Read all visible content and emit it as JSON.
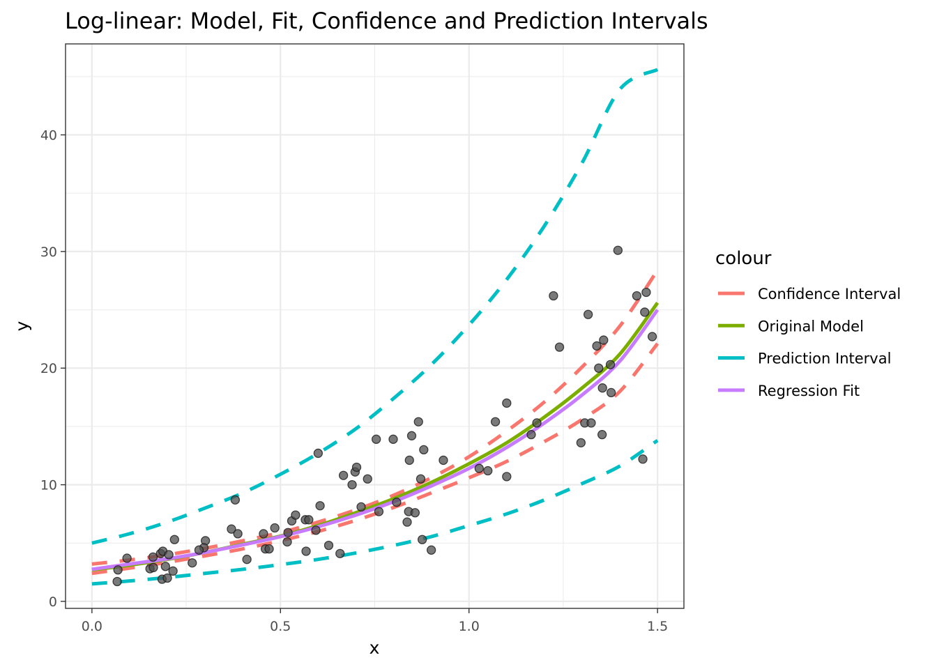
{
  "chart_data": {
    "type": "scatter",
    "title": "Log-linear: Model, Fit, Confidence and Prediction Intervals",
    "xlabel": "x",
    "ylabel": "y",
    "xlim": [
      -0.07,
      1.57
    ],
    "ylim": [
      -0.6,
      47.8
    ],
    "x_ticks": [
      0.0,
      0.5,
      1.0,
      1.5
    ],
    "x_tick_labels": [
      "0.0",
      "0.5",
      "1.0",
      "1.5"
    ],
    "y_ticks": [
      0,
      10,
      20,
      30,
      40
    ],
    "y_tick_labels": [
      "0",
      "10",
      "20",
      "30",
      "40"
    ],
    "grid": true,
    "legend": {
      "title": "colour",
      "position": "right",
      "entries": [
        {
          "label": "Confidence Interval",
          "color": "#F8766D",
          "dash": true
        },
        {
          "label": "Original Model",
          "color": "#7CAE00",
          "dash": false
        },
        {
          "label": "Prediction Interval",
          "color": "#00BFC4",
          "dash": true
        },
        {
          "label": "Regression Fit",
          "color": "#C77CFF",
          "dash": false
        }
      ]
    },
    "points": {
      "color": "#333333",
      "x": [
        0.067,
        0.069,
        0.093,
        0.154,
        0.163,
        0.162,
        0.182,
        0.186,
        0.188,
        0.195,
        0.2,
        0.204,
        0.215,
        0.219,
        0.266,
        0.301,
        0.297,
        0.284,
        0.37,
        0.38,
        0.387,
        0.411,
        0.455,
        0.46,
        0.47,
        0.485,
        0.518,
        0.52,
        0.53,
        0.54,
        0.566,
        0.568,
        0.575,
        0.594,
        0.6,
        0.605,
        0.628,
        0.658,
        0.667,
        0.69,
        0.698,
        0.702,
        0.714,
        0.731,
        0.754,
        0.761,
        0.799,
        0.808,
        0.836,
        0.84,
        0.842,
        0.848,
        0.857,
        0.866,
        0.872,
        0.876,
        0.88,
        0.9,
        0.932,
        1.027,
        1.05,
        1.07,
        1.1,
        1.1,
        1.165,
        1.18,
        1.224,
        1.24,
        1.297,
        1.307,
        1.316,
        1.324,
        1.339,
        1.344,
        1.354,
        1.357,
        1.353,
        1.375,
        1.377,
        1.395,
        1.445,
        1.461,
        1.466,
        1.47,
        1.486
      ],
      "y": [
        1.7,
        2.7,
        3.7,
        2.8,
        2.9,
        3.8,
        4.1,
        1.9,
        4.3,
        3.0,
        2.0,
        4.0,
        2.6,
        5.3,
        3.3,
        5.2,
        4.6,
        4.4,
        6.2,
        8.7,
        5.8,
        3.6,
        5.8,
        4.5,
        4.5,
        6.3,
        5.1,
        5.9,
        6.9,
        7.4,
        7.0,
        4.3,
        7.0,
        6.1,
        12.7,
        8.2,
        4.8,
        4.1,
        10.8,
        10.0,
        11.1,
        11.5,
        8.1,
        10.5,
        13.9,
        7.7,
        13.9,
        8.5,
        6.8,
        7.7,
        12.1,
        14.2,
        7.6,
        15.4,
        10.5,
        5.3,
        13.0,
        4.4,
        12.1,
        11.4,
        11.2,
        15.4,
        10.7,
        17.0,
        14.3,
        15.3,
        26.2,
        21.8,
        13.6,
        15.3,
        24.6,
        15.3,
        21.9,
        20.0,
        18.3,
        22.4,
        14.3,
        20.3,
        17.9,
        30.1,
        26.2,
        12.2,
        24.8,
        26.5,
        22.7
      ]
    },
    "curves": {
      "x": [
        0.0,
        0.1,
        0.2,
        0.3,
        0.4,
        0.5,
        0.6,
        0.7,
        0.8,
        0.9,
        1.0,
        1.1,
        1.2,
        1.3,
        1.4,
        1.5
      ],
      "original_model": [
        2.7,
        3.1,
        3.6,
        4.2,
        4.9,
        5.6,
        6.5,
        7.6,
        8.8,
        10.2,
        11.8,
        13.6,
        15.8,
        18.3,
        21.2,
        25.6
      ],
      "regression_fit": [
        2.75,
        3.2,
        3.65,
        4.2,
        4.85,
        5.55,
        6.4,
        7.4,
        8.55,
        9.9,
        11.4,
        13.2,
        15.3,
        17.7,
        20.6,
        25.0
      ],
      "ci_upper": [
        3.2,
        3.55,
        4.0,
        4.55,
        5.2,
        5.9,
        6.8,
        7.85,
        9.1,
        10.6,
        12.4,
        14.6,
        17.1,
        20.1,
        23.6,
        28.4
      ],
      "ci_lower": [
        2.4,
        2.85,
        3.35,
        3.9,
        4.5,
        5.2,
        6.0,
        6.95,
        8.05,
        9.3,
        10.6,
        12.0,
        13.7,
        15.6,
        18.0,
        22.1
      ],
      "pi_upper": [
        5.0,
        5.8,
        6.8,
        8.0,
        9.3,
        10.9,
        12.7,
        14.8,
        17.4,
        20.3,
        23.7,
        27.6,
        32.2,
        37.6,
        43.9,
        45.6
      ],
      "pi_lower": [
        1.5,
        1.75,
        2.05,
        2.4,
        2.75,
        3.15,
        3.6,
        4.15,
        4.8,
        5.55,
        6.5,
        7.5,
        8.7,
        10.1,
        11.6,
        13.8
      ]
    }
  }
}
